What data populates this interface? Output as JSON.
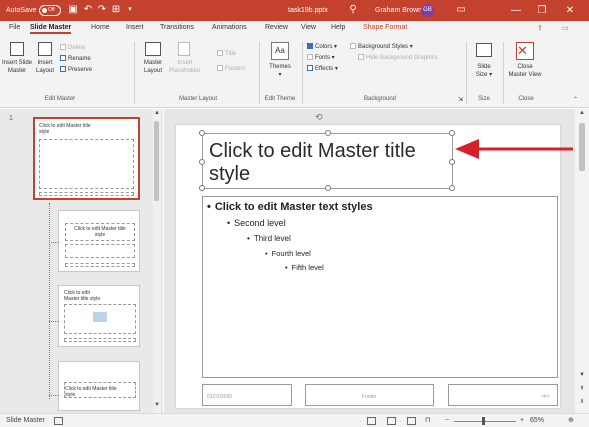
{
  "titlebar": {
    "autosave_label": "AutoSave",
    "autosave_state": "Off",
    "filename": "task19b.pptx",
    "search_icon": "search-icon",
    "user_name": "Graham Brown",
    "user_initials": "GB",
    "bg_color": "#c4422d",
    "minimize": "—",
    "restore": "❐",
    "close": "✕"
  },
  "tabs": [
    {
      "label": "File"
    },
    {
      "label": "Slide Master"
    },
    {
      "label": "Home"
    },
    {
      "label": "Insert"
    },
    {
      "label": "Transitions"
    },
    {
      "label": "Animations"
    },
    {
      "label": "Review"
    },
    {
      "label": "View"
    },
    {
      "label": "Help"
    },
    {
      "label": "Shape Format"
    }
  ],
  "ribbon": {
    "edit_master": {
      "insert_slide_master": "Insert Slide Master",
      "insert_slide_line1": "Insert Slide",
      "insert_slide_line2": "Master",
      "insert_layout_line1": "Insert",
      "insert_layout_line2": "Layout",
      "delete": "Delete",
      "rename": "Rename",
      "preserve": "Preserve",
      "group_label": "Edit Master"
    },
    "master_layout": {
      "master_layout_line1": "Master",
      "master_layout_line2": "Layout",
      "insert_placeholder_line1": "Insert",
      "insert_placeholder_line2": "Placeholder",
      "title": "Title",
      "footers": "Footers",
      "group_label": "Master Layout"
    },
    "edit_theme": {
      "themes": "Themes",
      "group_label": "Edit Theme"
    },
    "background": {
      "colors": "Colors",
      "fonts": "Fonts",
      "effects": "Effects",
      "background_styles": "Background Styles",
      "hide_background_graphics": "Hide Background Graphics",
      "group_label": "Background"
    },
    "size": {
      "slide_size_line1": "Slide",
      "slide_size_line2": "Size",
      "group_label": "Size"
    },
    "close": {
      "close_master_view_line1": "Close",
      "close_master_view_line2": "Master View",
      "group_label": "Close"
    }
  },
  "thumbnails": {
    "first_number": "1",
    "items": [
      {
        "title": "Click to edit Master title style"
      },
      {
        "title": "Click to edit Master title style"
      },
      {
        "title": "Click to edit Master title style"
      },
      {
        "title": "Click to edit Master title style"
      }
    ]
  },
  "slide": {
    "title": "Click to edit Master title style",
    "levels": [
      {
        "text": "Click to edit Master text styles"
      },
      {
        "text": "Second level"
      },
      {
        "text": "Third level"
      },
      {
        "text": "Fourth level"
      },
      {
        "text": "Fifth level"
      }
    ],
    "footer_date": "01/01/2020",
    "footer_text": "Footer",
    "footer_num": "<#>"
  },
  "statusbar": {
    "view_label": "Slide Master",
    "zoom_minus": "−",
    "zoom_plus": "+",
    "zoom_percent": "65%"
  },
  "colors": {
    "accent": "#c4422d",
    "arrow": "#d8202a"
  }
}
